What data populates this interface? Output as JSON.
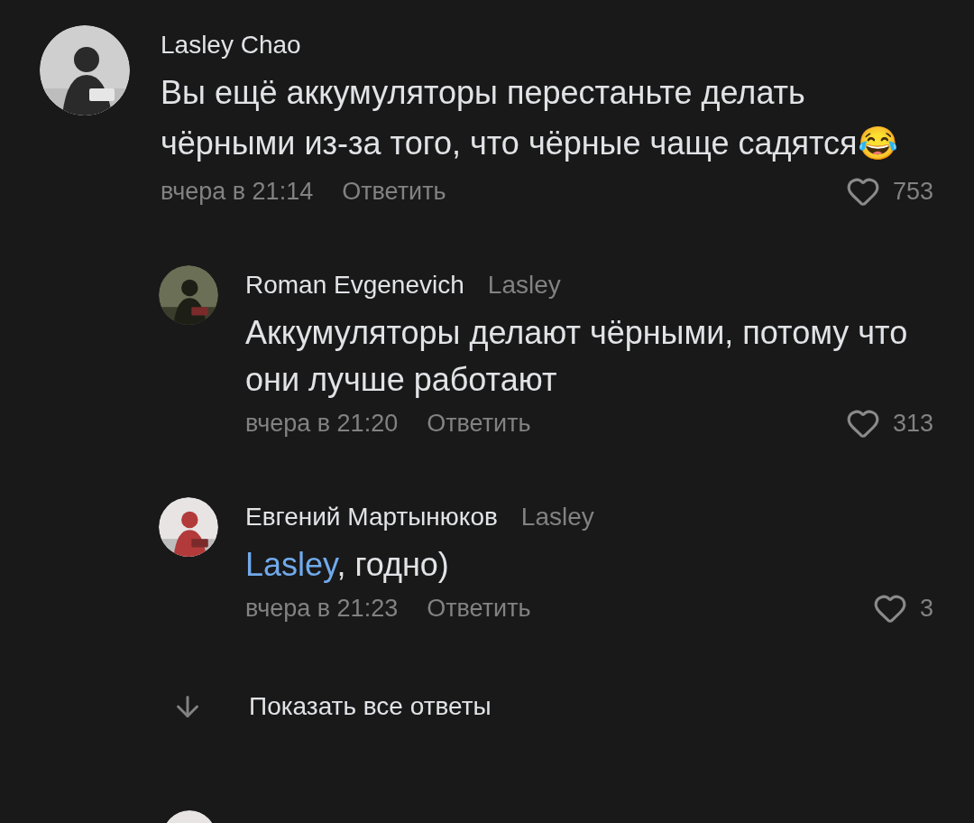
{
  "comment": {
    "author": "Lasley Chao",
    "text": "Вы ещё аккумуляторы перестаньте делать чёрными из-за того, что чёрные чаще садятся😂",
    "time": "вчера в 21:14",
    "reply_label": "Ответить",
    "likes": "753",
    "replies": [
      {
        "author": "Roman Evgenevich",
        "reply_to": "Lasley",
        "text": "Аккумуляторы делают чёрными, потому что они лучше работают",
        "time": "вчера в 21:20",
        "reply_label": "Ответить",
        "likes": "313"
      },
      {
        "author": "Евгений Мартынюков",
        "reply_to": "Lasley",
        "mention": "Lasley",
        "text": ", годно)",
        "time": "вчера в 21:23",
        "reply_label": "Ответить",
        "likes": "3"
      }
    ]
  },
  "show_all": {
    "label": "Показать все ответы"
  }
}
